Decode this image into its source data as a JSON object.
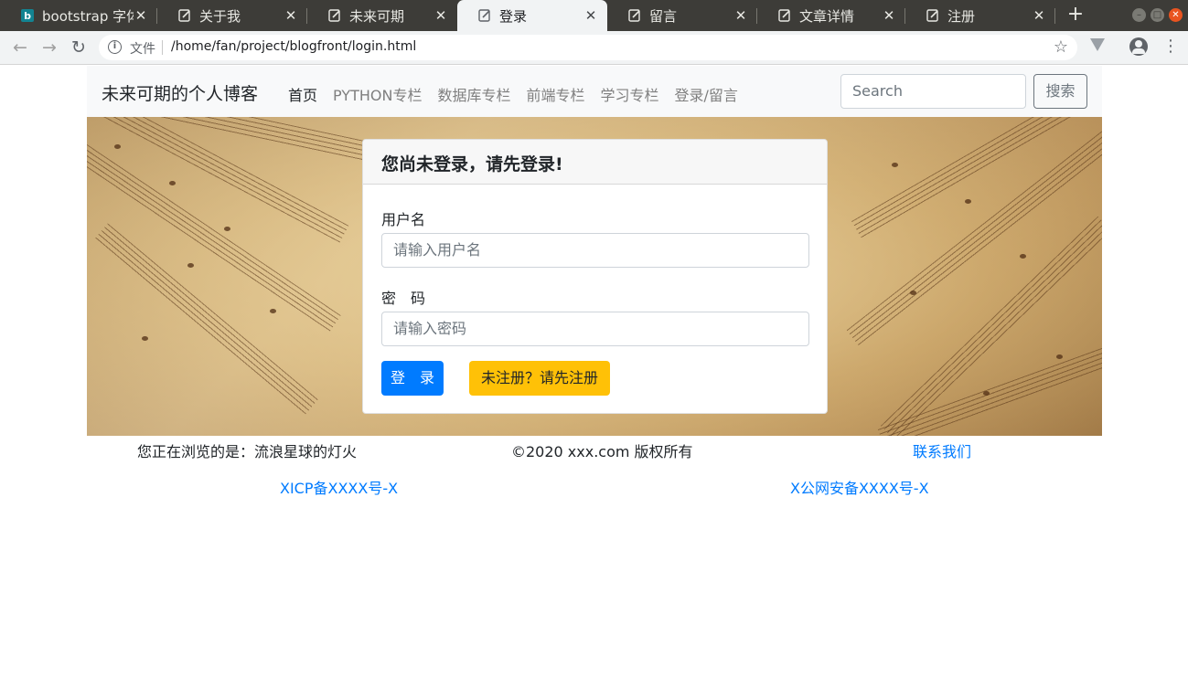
{
  "browser": {
    "tabs": [
      {
        "title": "bootstrap 字体",
        "icon": "bing-icon",
        "active": false
      },
      {
        "title": "关于我",
        "icon": "page-icon",
        "active": false
      },
      {
        "title": "未来可期",
        "icon": "page-icon",
        "active": false
      },
      {
        "title": "登录",
        "icon": "page-icon",
        "active": true
      },
      {
        "title": "留言",
        "icon": "page-icon",
        "active": false
      },
      {
        "title": "文章详情",
        "icon": "page-icon",
        "active": false
      },
      {
        "title": "注册",
        "icon": "page-icon",
        "active": false
      }
    ],
    "new_tab": "+",
    "omnibox": {
      "scheme_label": "文件",
      "url": "/home/fan/project/blogfront/login.html"
    }
  },
  "nav": {
    "brand": "未来可期的个人博客",
    "links": [
      "首页",
      "PYTHON专栏",
      "数据库专栏",
      "前端专栏",
      "学习专栏",
      "登录/留言"
    ],
    "active_link": "首页",
    "search_placeholder": "Search",
    "search_button": "搜索"
  },
  "login_card": {
    "header": "您尚未登录，请先登录!",
    "username_label": "用户名",
    "username_placeholder": "请输入用户名",
    "password_label": "密　码",
    "password_placeholder": "请输入密码",
    "login_button": "登　录",
    "register_button": "未注册？请先注册"
  },
  "footer": {
    "browsing": "您正在浏览的是：流浪星球的灯火",
    "copyright": "©2020 xxx.com 版权所有",
    "contact": "联系我们",
    "icp": "XICP备XXXX号-X",
    "police": "X公网安备XXXX号-X"
  },
  "colors": {
    "primary": "#007bff",
    "warning": "#ffc107",
    "navbar_bg": "#f8f9fa",
    "tabbar_bg": "#3d3c38"
  }
}
